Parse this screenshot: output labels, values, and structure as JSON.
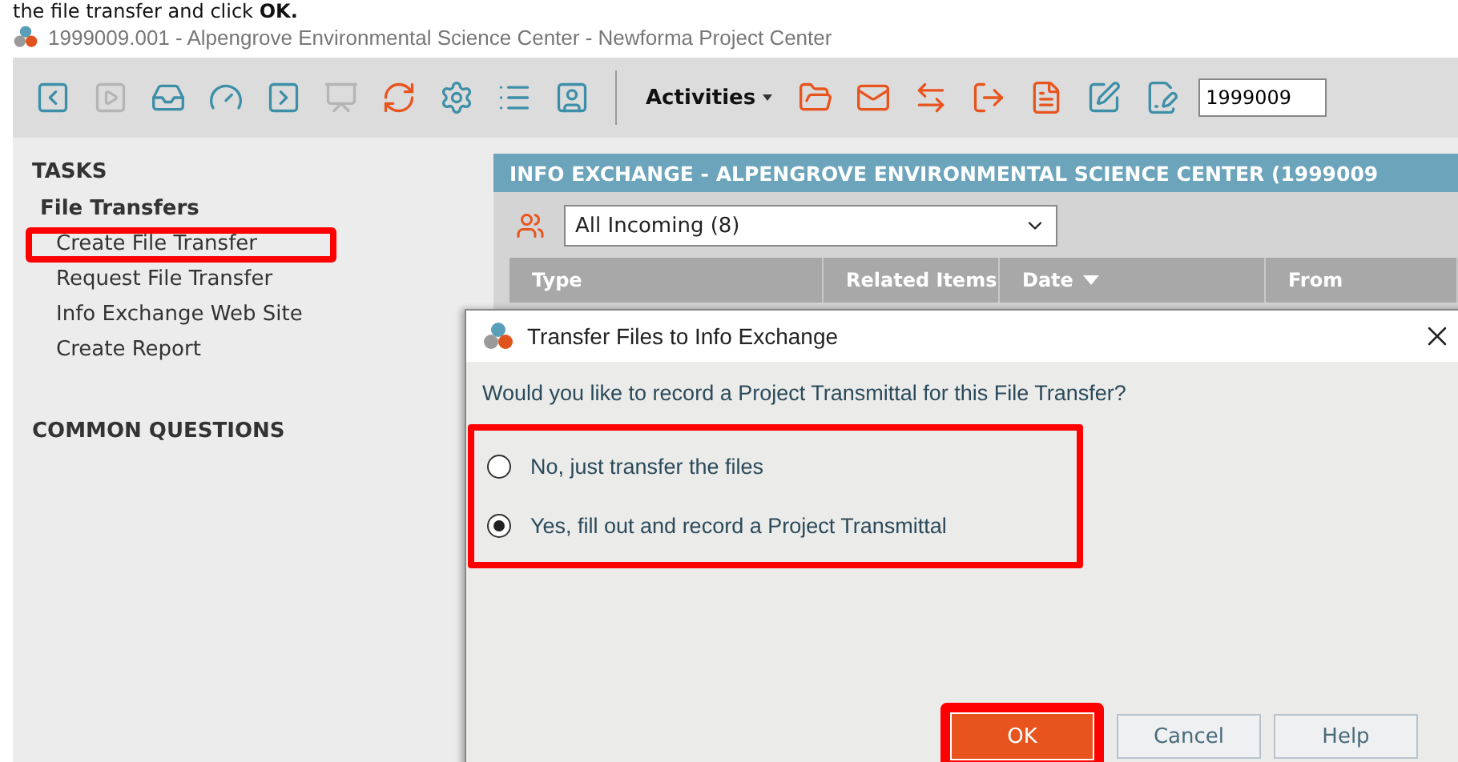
{
  "caption": "the file transfer and click **OK.**",
  "window": {
    "title": "1999009.001 - Alpengrove Environmental Science Center - Newforma Project Center"
  },
  "toolbar": {
    "left_tools": [
      {
        "kind": "back",
        "disabled": false
      },
      {
        "kind": "forward",
        "disabled": true
      },
      {
        "kind": "inbox-person",
        "disabled": false
      },
      {
        "kind": "gauge",
        "disabled": false
      },
      {
        "kind": "swap",
        "disabled": false
      },
      {
        "kind": "presentation",
        "disabled": true
      },
      {
        "kind": "refresh",
        "disabled": false
      },
      {
        "kind": "gear",
        "disabled": false
      },
      {
        "kind": "list",
        "disabled": false
      },
      {
        "kind": "contact",
        "disabled": false
      }
    ],
    "activities": "Activities",
    "right_tools": [
      {
        "kind": "folder",
        "disabled": false
      },
      {
        "kind": "mail",
        "disabled": false
      },
      {
        "kind": "arrows",
        "disabled": false
      },
      {
        "kind": "export",
        "disabled": false
      },
      {
        "kind": "file",
        "disabled": false
      },
      {
        "kind": "edit",
        "disabled": false
      },
      {
        "kind": "signature",
        "disabled": false
      }
    ],
    "project_field": "1999009"
  },
  "sidebar": {
    "tasks_heading": "TASKS",
    "group": "File Transfers",
    "items": [
      {
        "label": "Create File Transfer",
        "highlighted": true
      },
      {
        "label": "Request File Transfer",
        "highlighted": false
      },
      {
        "label": "Info Exchange Web Site",
        "highlighted": false
      },
      {
        "label": "Create Report",
        "highlighted": false
      }
    ],
    "questions_heading": "COMMON QUESTIONS"
  },
  "panel": {
    "title": "INFO EXCHANGE - ALPENGROVE ENVIRONMENTAL SCIENCE CENTER (1999009",
    "filter": "All Incoming (8)",
    "columns": [
      {
        "label": "Type",
        "sorted": false
      },
      {
        "label": "Related Items",
        "sorted": false
      },
      {
        "label": "Date",
        "sorted": true
      },
      {
        "label": "From",
        "sorted": false
      }
    ]
  },
  "dialog": {
    "title": "Transfer Files to Info Exchange",
    "question": "Would you like to record a Project Transmittal for this File Transfer?",
    "options_highlighted": true,
    "options": [
      {
        "label": "No, just transfer the files",
        "selected": false
      },
      {
        "label": "Yes, fill out and record a Project Transmittal",
        "selected": true
      }
    ],
    "buttons": [
      {
        "label": "OK",
        "primary": true,
        "highlighted": true
      },
      {
        "label": "Cancel",
        "primary": false,
        "highlighted": false
      },
      {
        "label": "Help",
        "primary": false,
        "highlighted": false
      }
    ]
  }
}
